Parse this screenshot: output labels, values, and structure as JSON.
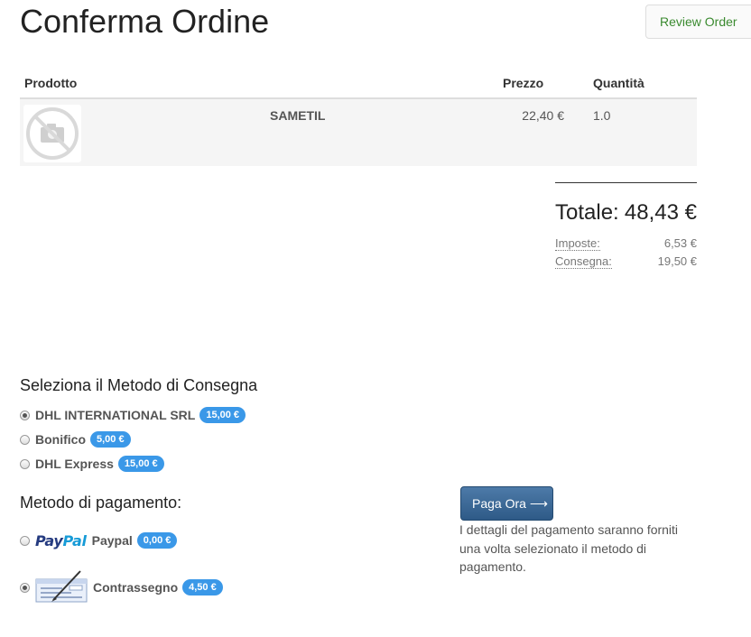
{
  "page": {
    "title": "Conferma Ordine",
    "review_button": "Review Order"
  },
  "table": {
    "headers": {
      "product": "Prodotto",
      "price": "Prezzo",
      "quantity": "Quantità"
    },
    "rows": [
      {
        "image_icon": "no-image-camera-icon",
        "name": "SAMETIL",
        "price": "22,40 €",
        "quantity": "1.0"
      }
    ]
  },
  "totals": {
    "total_label": "Totale:",
    "total_value": "48,43 €",
    "taxes_label": "Imposte:",
    "taxes_value": "6,53 €",
    "shipping_label": "Consegna:",
    "shipping_value": "19,50 €"
  },
  "delivery": {
    "title": "Seleziona il Metodo di Consegna",
    "options": [
      {
        "label": "DHL INTERNATIONAL SRL",
        "price": "15,00 €",
        "selected": true
      },
      {
        "label": "Bonifico",
        "price": "5,00 €",
        "selected": false
      },
      {
        "label": "DHL Express",
        "price": "15,00 €",
        "selected": false
      }
    ]
  },
  "payment": {
    "title": "Metodo di pagamento:",
    "options": [
      {
        "logo_part1": "Pay",
        "logo_part2": "Pal",
        "label": "Paypal",
        "price": "0,00 €",
        "selected": false
      },
      {
        "logo_icon": "cheque-icon",
        "label": "Contrassegno",
        "price": "4,50 €",
        "selected": true
      }
    ],
    "pay_button": "Paga Ora",
    "note": "I dettagli del pagamento saranno forniti una volta selezionato il metodo di pagamento."
  },
  "colors": {
    "badge": "#3a98e8",
    "pay_button": "#3a6796",
    "review_text": "#3a8a2f"
  }
}
